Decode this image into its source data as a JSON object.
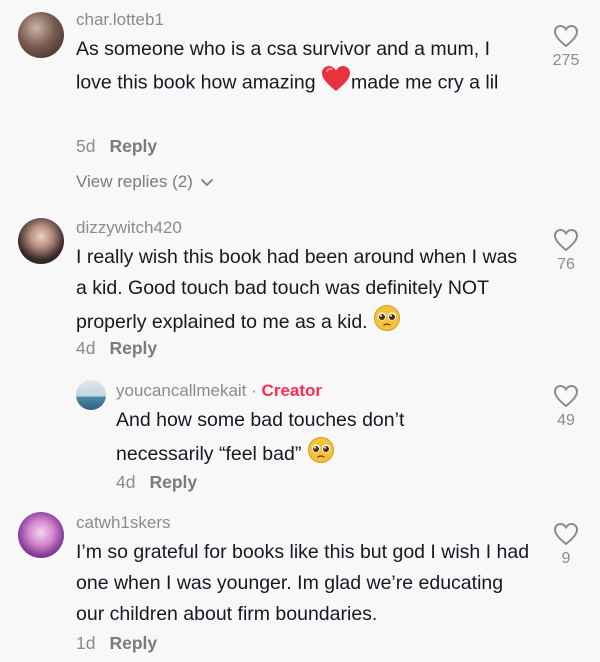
{
  "comments": [
    {
      "username": "char.lotteb1",
      "text_before": "As someone who is a csa survivor and a mum, I love this book how amazing",
      "text_after": "made me cry a lil",
      "time": "5d",
      "reply": "Reply",
      "view_replies": "View replies (2)",
      "likes": "275"
    },
    {
      "username": "dizzywitch420",
      "text": "I really wish this book had been around when I was a kid. Good touch bad touch was definitely NOT properly explained to me as a kid.",
      "time": "4d",
      "reply": "Reply",
      "likes": "76"
    },
    {
      "username": "youcancallmekait",
      "separator": "·",
      "badge": "Creator",
      "text": "And how some bad touches don’t necessarily “feel bad”",
      "time": "4d",
      "reply": "Reply",
      "likes": "49"
    },
    {
      "username": "catwh1skers",
      "text": "I’m so grateful for books like this but god I wish I had one when I was younger. Im glad we’re educating our children about firm boundaries.",
      "time": "1d",
      "reply": "Reply",
      "likes": "9"
    }
  ],
  "colors": {
    "background": "#f8f8f8",
    "creator_badge": "#fe2c55",
    "secondary_text": "#8a8b91",
    "heart_emoji": "#e8323f",
    "pleading_emoji": "#f5c33b"
  },
  "icons": [
    "heart-outline-icon",
    "red-heart-emoji",
    "pleading-face-emoji",
    "chevron-down-icon"
  ]
}
